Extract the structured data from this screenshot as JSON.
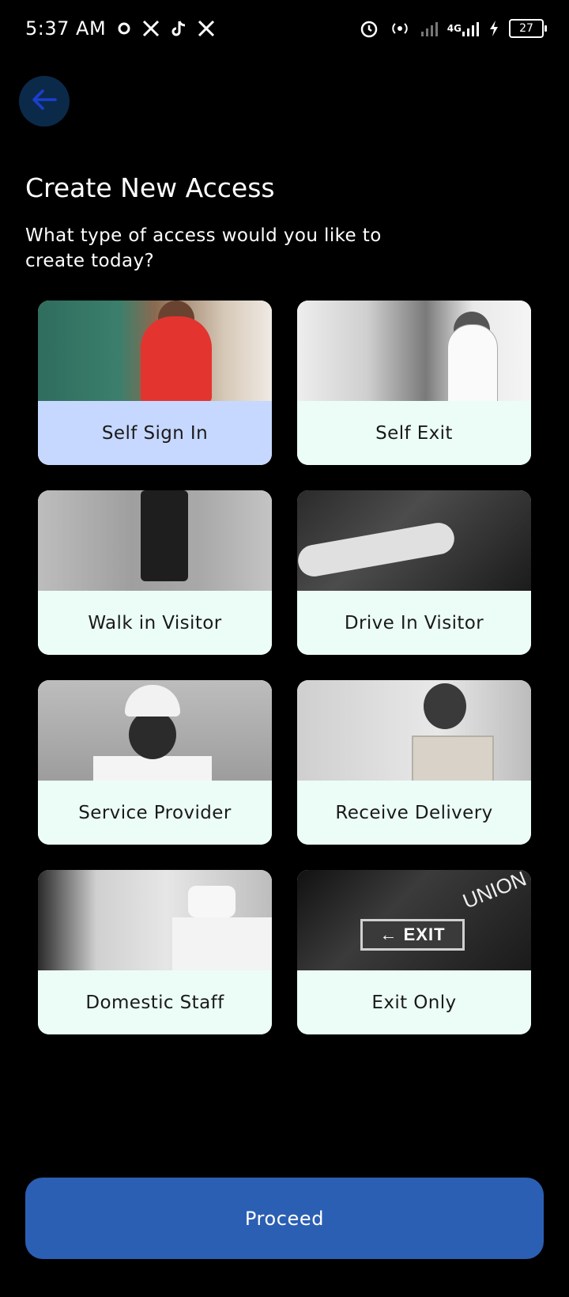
{
  "status_bar": {
    "time": "5:37 AM",
    "left_icons": [
      "sync-icon",
      "x-icon",
      "tiktok-icon",
      "x-icon"
    ],
    "right_icons": [
      "alarm-icon",
      "hotspot-icon",
      "signal-icon",
      "signal-4g-icon",
      "charging-icon"
    ],
    "network": "4G",
    "battery": "27"
  },
  "header": {
    "back_icon": "arrow-left-icon",
    "title": "Create New Access",
    "subtitle": "What type of access would you like to create today?"
  },
  "access_types": [
    {
      "id": "self-sign-in",
      "label": "Self Sign In",
      "selected": true
    },
    {
      "id": "self-exit",
      "label": "Self Exit",
      "selected": false
    },
    {
      "id": "walk-in-visitor",
      "label": "Walk in Visitor",
      "selected": false
    },
    {
      "id": "drive-in-visitor",
      "label": "Drive In Visitor",
      "selected": false
    },
    {
      "id": "service-provider",
      "label": "Service Provider",
      "selected": false
    },
    {
      "id": "receive-delivery",
      "label": "Receive Delivery",
      "selected": false
    },
    {
      "id": "domestic-staff",
      "label": "Domestic Staff",
      "selected": false
    },
    {
      "id": "exit-only",
      "label": "Exit Only",
      "selected": false
    }
  ],
  "exit_sign_text": "EXIT",
  "exit_sign_arrow": "←",
  "union_text": "UNION",
  "footer": {
    "proceed_label": "Proceed"
  },
  "colors": {
    "background": "#000000",
    "card": "#ecfdf7",
    "selected_card": "#c6d8ff",
    "primary": "#2b5fb3",
    "back_button": "#0b2a4a"
  }
}
